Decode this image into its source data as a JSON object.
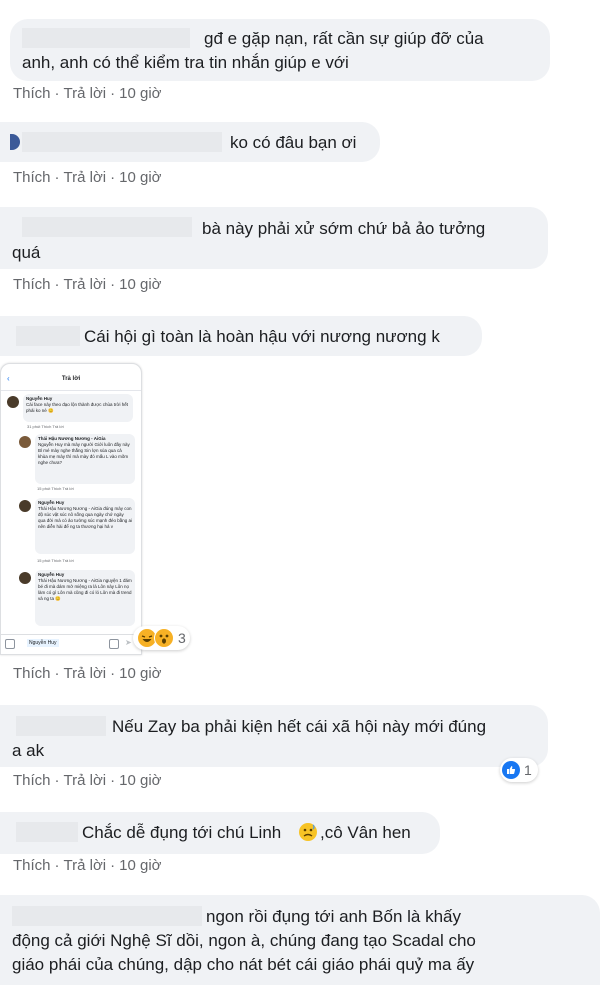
{
  "action_like": "Thích",
  "action_reply": "Trả lời",
  "action_sep": "·",
  "comments": [
    {
      "lines": [
        "gđ e gặp nạn, rất cần sự giúp đỡ của",
        "anh, anh có thể kiểm tra tin nhắn giúp e với"
      ],
      "time": "10 giờ"
    },
    {
      "lines": [
        "ko có đâu bạn ơi"
      ],
      "time": "10 giờ"
    },
    {
      "lines": [
        "bà này phải xử sớm chứ bả ảo tưởng",
        "quá"
      ],
      "time": "10 giờ"
    },
    {
      "lines": [
        "Cái hội gì toàn là hoàn hậu với nương nương k"
      ],
      "time": "10 giờ",
      "image_title": "Trả lời",
      "reaction_count": "3"
    },
    {
      "lines": [
        "Nếu Zay ba phải kiện hết cái xã hội này mới đúng",
        "a ak"
      ],
      "time": "10 giờ",
      "reaction_count": "1"
    },
    {
      "lines": [
        "Chắc dễ đụng tới chú Linh",
        ",cô Vân hen"
      ],
      "time": "10 giờ"
    },
    {
      "lines": [
        "ngon rồi đụng tới anh Bốn là khấy",
        "động cả giới Nghệ Sĩ dồi, ngon à, chúng đang tạo Scadal cho",
        "giáo phái của chúng, dập cho nát bét cái giáo phái quỷ ma ấy"
      ]
    }
  ],
  "screenshot_items": [
    {
      "name": "Nguyễn Huy",
      "text": "Cái face này theo đạo lộn thành được chùa trời hết phải ko nè 😊",
      "meta": "31 phút   Thích   Trả lời"
    },
    {
      "name": "Thái Hậu Nương Nương - AiGia",
      "text": "Nguyễn Huy mà mày người Giới luôn đây này Bỉ mé mày nghe thằng Sin lợn sủa qua cả khùa mẹ mày thì mà mày đó mấu L vào mõm nghe chưa?",
      "meta": "15 phút   Thích   Trả lời"
    },
    {
      "name": "Nguyễn Huy",
      "text": "Thái Hậu Nương Nương - AiGia đúng mày con độ súc vật súc nô sống qua ngày chớ ngày qua đời mà có ảo tưởng súc mạnh đéo bằng ai nên diễn hài để ng ta thương hại hả v",
      "meta": "15 phút   Thích   Trả lời"
    },
    {
      "name": "Nguyễn Huy",
      "text": "Thái Hậu Nương Nương - AiGia nguyện 1 đám bé đi mà dám mở miệng ra là Lôn này Lôn nọ làm có gì Lôn mà cũng đi có ló Lôn mà đi trend và ng ta 😊",
      "meta": "15 phút   Thích   Trả lời"
    }
  ],
  "screenshot_input": "Nguyễn Huy"
}
